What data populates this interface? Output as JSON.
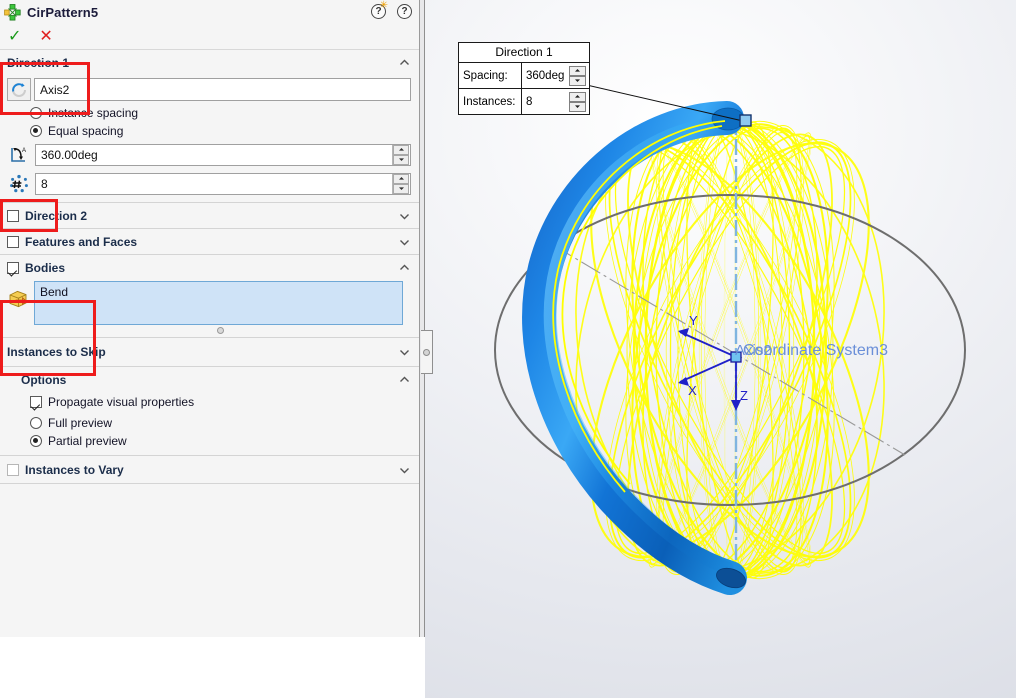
{
  "panel": {
    "title": "CirPattern5",
    "title_icon": "circular-pattern-icon",
    "help_whats_new": "whats-new-help-icon",
    "help": "help-icon",
    "accept_label": "✓",
    "cancel_label": "✕",
    "direction1": {
      "heading": "Direction 1",
      "axis_icon": "rotation-axis-icon",
      "axis_value": "Axis2",
      "instance_spacing_label": "Instance spacing",
      "instance_spacing_selected": false,
      "equal_spacing_label": "Equal spacing",
      "equal_spacing_selected": true,
      "angle_icon": "angle-icon",
      "angle_value": "360.00deg",
      "count_icon": "instance-count-icon",
      "count_value": "8"
    },
    "direction2": {
      "heading": "Direction 2",
      "checked": false
    },
    "features_faces": {
      "heading": "Features and Faces",
      "checked": false
    },
    "bodies": {
      "heading": "Bodies",
      "checked": true,
      "body_icon": "solid-body-icon",
      "items": [
        "Bend"
      ]
    },
    "instances_to_skip": {
      "heading": "Instances to Skip"
    },
    "options": {
      "heading": "Options",
      "propagate_label": "Propagate visual properties",
      "propagate_checked": true,
      "full_preview_label": "Full preview",
      "full_preview_selected": false,
      "partial_preview_label": "Partial preview",
      "partial_preview_selected": true
    },
    "instances_to_vary": {
      "heading": "Instances to Vary",
      "checked": false
    }
  },
  "callout": {
    "title": "Direction 1",
    "spacing_label": "Spacing:",
    "spacing_value": "360deg",
    "instances_label": "Instances:",
    "instances_value": "8"
  },
  "graphics": {
    "coordinate_system_label": "Coordinate System3",
    "axis_label": "Axis2",
    "axis_x_label": "X",
    "axis_y_label": "Y",
    "axis_z_label": "Z"
  },
  "colors": {
    "body_blue": "#0a7fe0",
    "preview_yellow": "#ffff00",
    "annotation_red": "#ee1c1c",
    "selection_blue": "#cfe3f7",
    "accept_green": "#1a9a1a",
    "cancel_red": "#e02020",
    "panel_bg": "#f5f5f5",
    "equator_gray": "#6e6e6e",
    "triad_blue": "#2020c8"
  }
}
